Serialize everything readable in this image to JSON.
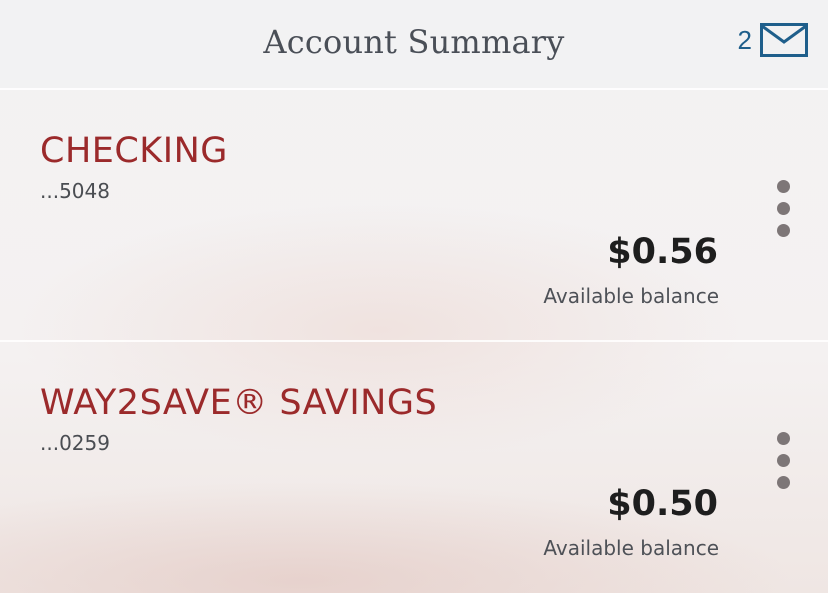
{
  "header": {
    "title": "Account Summary",
    "message_count": "2",
    "message_icon": "mail-envelope-icon"
  },
  "accounts": [
    {
      "name": "CHECKING",
      "number": "...5048",
      "balance": "$0.56",
      "balance_label": "Available balance"
    },
    {
      "name": "WAY2SAVE® SAVINGS",
      "number": "...0259",
      "balance": "$0.50",
      "balance_label": "Available balance"
    }
  ],
  "colors": {
    "account_name": "#9b2a2b",
    "accent_blue": "#1f5f8b",
    "kebab_dots": "#7d7677"
  }
}
